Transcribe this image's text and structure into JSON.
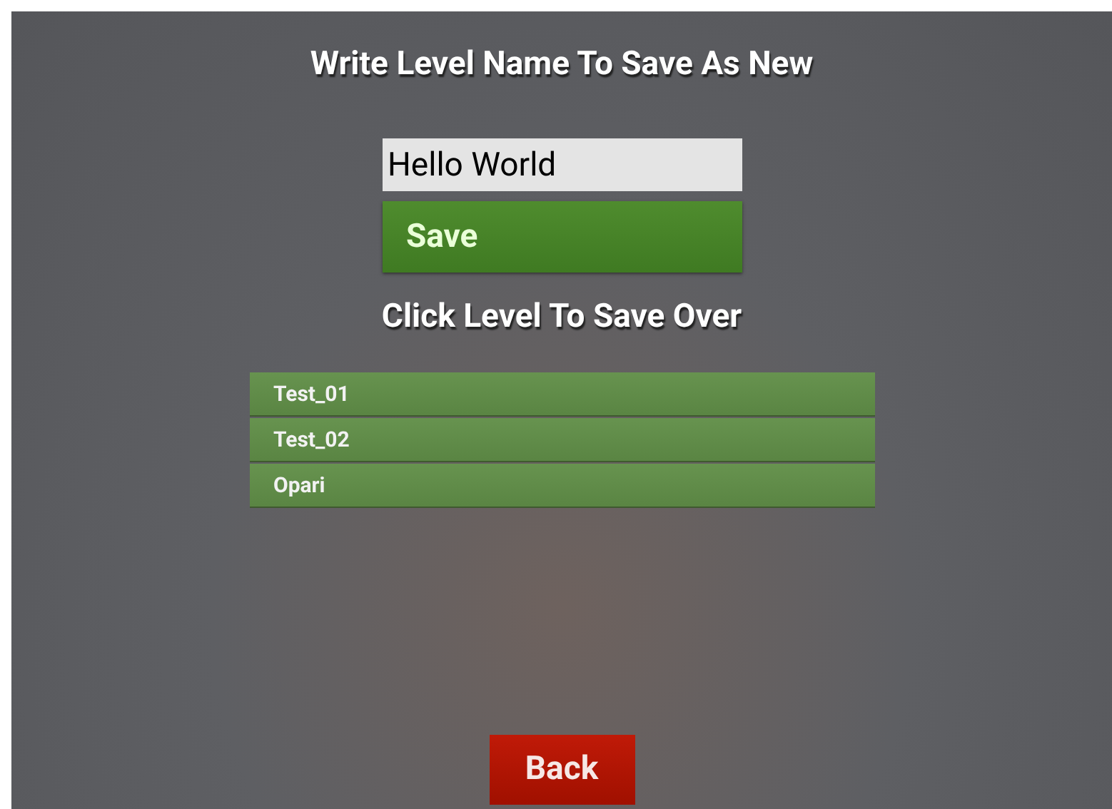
{
  "title": "Write Level Name To Save As New",
  "name_field": {
    "value": "Hello World"
  },
  "save_button": "Save",
  "list_heading": "Click Level To Save Over",
  "levels": [
    {
      "name": "Test_01"
    },
    {
      "name": "Test_02"
    },
    {
      "name": "Opari"
    }
  ],
  "back_button": "Back"
}
